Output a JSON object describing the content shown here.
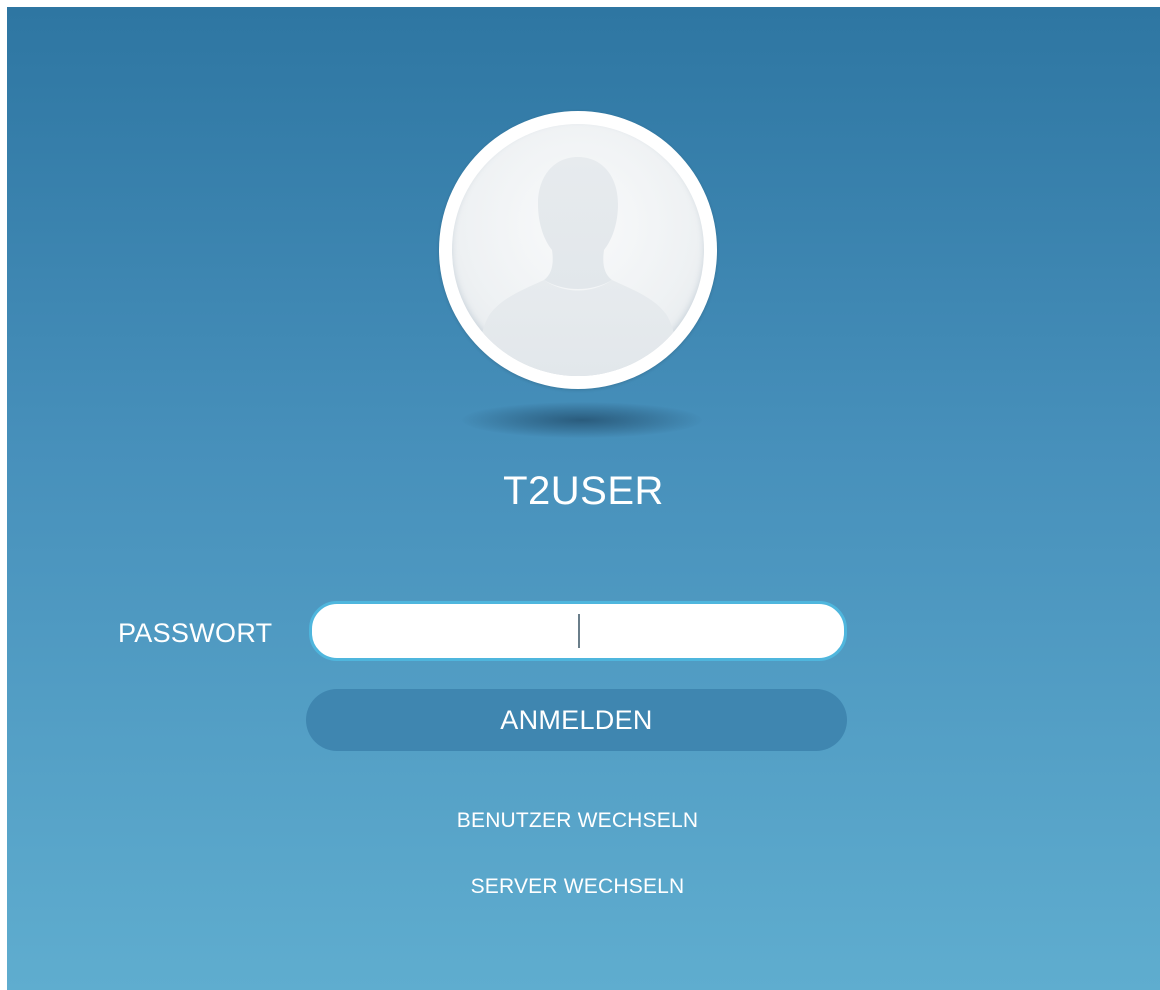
{
  "user": {
    "name": "T2USER",
    "avatar_icon": "user-silhouette-icon"
  },
  "password": {
    "label": "PASSWORT",
    "value": "",
    "placeholder": ""
  },
  "login_button": {
    "label": "ANMELDEN"
  },
  "links": {
    "switch_user": "BENUTZER WECHSELN",
    "switch_server": "SERVER WECHSELN"
  },
  "colors": {
    "background_top": "#2e76a2",
    "background_bottom": "#5fadcf",
    "input_border": "#4fb6dd",
    "button_fill": "#3f86b0"
  }
}
